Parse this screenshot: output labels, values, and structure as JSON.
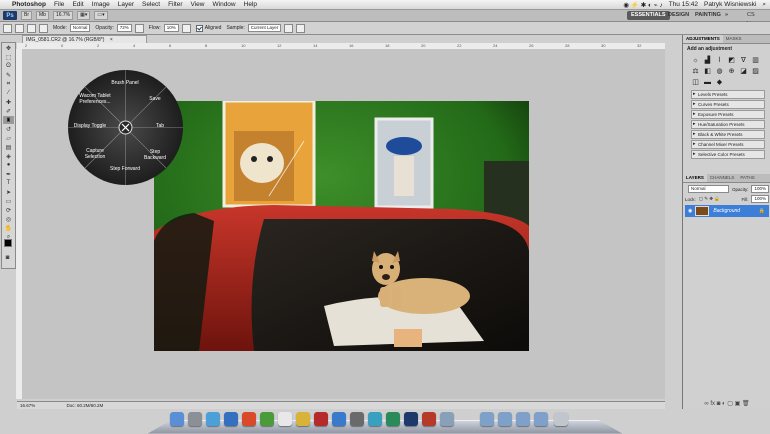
{
  "menubar": {
    "app_name": "Photoshop",
    "items": [
      "File",
      "Edit",
      "Image",
      "Layer",
      "Select",
      "Filter",
      "View",
      "Window",
      "Help"
    ],
    "status": {
      "day_time": "Thu 15:42",
      "user": "Patryk Wisniewski"
    }
  },
  "appbar": {
    "zoom_value": "16.7%",
    "workspaces": {
      "essentials": "ESSENTIALS",
      "design": "DESIGN",
      "painting": "PAINTING",
      "more": "»"
    },
    "cs_live": "CS Live"
  },
  "options": {
    "mode_label": "Mode:",
    "mode_value": "Normal",
    "opacity_label": "Opacity:",
    "opacity_value": "72%",
    "flow_label": "Flow:",
    "flow_value": "10%",
    "aligned_label": "Aligned",
    "sample_label": "Sample:",
    "sample_value": "Current Layer"
  },
  "document": {
    "tab_title": "IMG_0581.CR2 @ 16.7% (RGB/8*)",
    "ruler_ticks": [
      "2",
      "0",
      "2",
      "4",
      "6",
      "8",
      "10",
      "12",
      "14",
      "16",
      "18",
      "20",
      "22",
      "24",
      "26",
      "28",
      "30",
      "32"
    ],
    "status_zoom": "16.67%",
    "status_doc": "Doc: 60.2M/60.2M"
  },
  "pie_menu": {
    "items": [
      {
        "label": "Brush Panel"
      },
      {
        "label": "Save"
      },
      {
        "label": "Tab"
      },
      {
        "label": "Step Backward"
      },
      {
        "label": "Step Forward"
      },
      {
        "label": "Capture Selection"
      },
      {
        "label": "Display Toggle"
      },
      {
        "label": "Wacom Tablet Preferences..."
      }
    ],
    "center_icon": "close-icon"
  },
  "adjustments": {
    "tabs": [
      "ADJUSTMENTS",
      "MASKS"
    ],
    "heading": "Add an adjustment",
    "presets": [
      "Levels Presets",
      "Curves Presets",
      "Exposure Presets",
      "Hue/Saturation Presets",
      "Black & White Presets",
      "Channel Mixer Presets",
      "Selective Color Presets"
    ]
  },
  "layers": {
    "tabs": [
      "LAYERS",
      "CHANNELS",
      "PATHS"
    ],
    "blend_mode": "Normal",
    "opacity_label": "Opacity:",
    "opacity_value": "100%",
    "lock_label": "Lock:",
    "fill_label": "Fill:",
    "fill_value": "100%",
    "layer_name": "Background"
  },
  "colors": {
    "accent": "#3d7fd8",
    "photo_green": "#2f7a22",
    "car_red": "#b5281f"
  }
}
